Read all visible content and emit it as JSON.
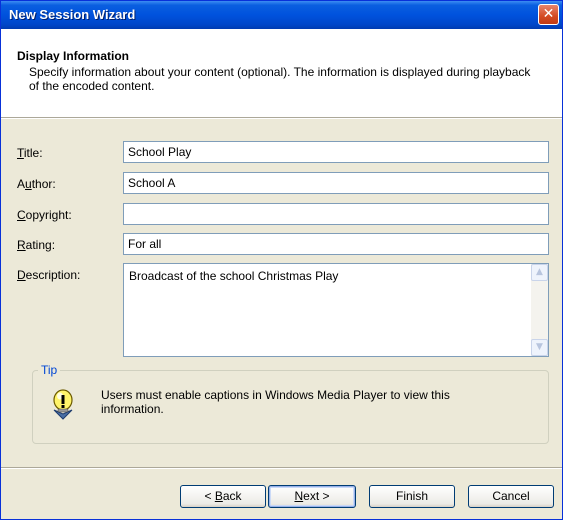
{
  "window": {
    "title": "New Session Wizard",
    "close_glyph": "✕"
  },
  "header": {
    "title": "Display Information",
    "description": "Specify information about your content (optional). The information is displayed during playback of the encoded content."
  },
  "form": {
    "title": {
      "label_key": "T",
      "label_rest": "itle:",
      "value": "School Play"
    },
    "author": {
      "label_pre": "A",
      "label_key": "u",
      "label_rest": "thor:",
      "value": "School A"
    },
    "copyright": {
      "label_key": "C",
      "label_rest": "opyright:",
      "value": ""
    },
    "rating": {
      "label_key": "R",
      "label_rest": "ating:",
      "value": "For all"
    },
    "description": {
      "label_key": "D",
      "label_rest": "escription:",
      "value": "Broadcast of the school Christmas Play"
    }
  },
  "tip": {
    "label": "Tip",
    "icon": "lightbulb-icon",
    "text": "Users must enable captions in Windows Media Player to view this information."
  },
  "buttons": {
    "back": {
      "prefix": "< ",
      "key": "B",
      "rest": "ack"
    },
    "next": {
      "key": "N",
      "rest": "ext >"
    },
    "finish": "Finish",
    "cancel": "Cancel"
  },
  "colors": {
    "titlebar": "#0052dd",
    "dialog_bg": "#ece9d8",
    "tip_label": "#0046d5"
  }
}
